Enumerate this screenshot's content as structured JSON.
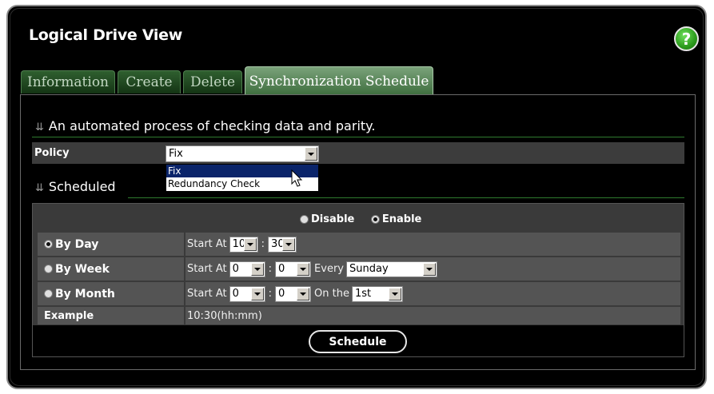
{
  "header": {
    "title": "Logical Drive View",
    "help_label": "?"
  },
  "tabs": [
    "Information",
    "Create",
    "Delete",
    "Synchronization Schedule"
  ],
  "active_tab": "Synchronization Schedule",
  "description": "An automated process of checking data and parity.",
  "policy": {
    "label": "Policy",
    "selected": "Fix",
    "options": [
      "Fix",
      "Redundancy Check"
    ],
    "highlighted": "Fix"
  },
  "scheduled": {
    "heading": "Scheduled",
    "disable_label": "Disable",
    "enable_label": "Enable",
    "enabled": true,
    "by_day": {
      "label": "By Day",
      "selected": true,
      "start_at_label": "Start At",
      "hour": "10",
      "minute": "30"
    },
    "by_week": {
      "label": "By Week",
      "selected": false,
      "start_at_label": "Start At",
      "hour": "0",
      "minute": "0",
      "every_label": "Every",
      "day": "Sunday"
    },
    "by_month": {
      "label": "By Month",
      "selected": false,
      "start_at_label": "Start At",
      "hour": "0",
      "minute": "0",
      "on_the_label": "On the",
      "date": "1st"
    },
    "example_label": "Example",
    "example_value": "10:30(hh:mm)",
    "colon": ":"
  },
  "schedule_button": "Schedule",
  "colors": {
    "accent_green": "#2f7a2f",
    "help_green": "#2b9a1c",
    "selection_blue": "#0a246a"
  }
}
